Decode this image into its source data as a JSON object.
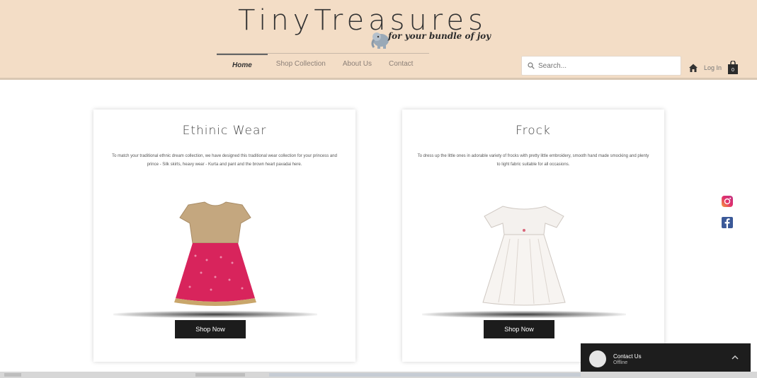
{
  "header": {
    "brand": "TinyTreasures",
    "tagline": "for your bundle of joy",
    "nav": [
      {
        "label": "Home",
        "active": true
      },
      {
        "label": "Shop Collection",
        "active": false
      },
      {
        "label": "About Us",
        "active": false
      },
      {
        "label": "Contact",
        "active": false
      }
    ],
    "search_placeholder": "Search...",
    "login_label": "Log In"
  },
  "cards": [
    {
      "title": "Ethinic Wear",
      "description": "To match your traditional ethnic dream collection, we have designed this traditional wear collection for your princess and prince - Silk skirts, heavy wear - Kurta and pant and the brown heart pavadai here.",
      "button": "Shop Now"
    },
    {
      "title": "Frock",
      "description": "To dress up the little ones in adorable variety of frocks with pretty little embroidery, smooth hand made smocking and plenty to light fabric suitable for all occasions.",
      "button": "Shop Now"
    }
  ],
  "chat": {
    "title": "Contact Us",
    "status": "Offline"
  },
  "colors": {
    "header_bg": "#f3ddc6",
    "button_bg": "#1c1c1c",
    "chat_bg": "#1d1d1d"
  },
  "icons": {
    "search": "search-icon",
    "home": "home-icon",
    "cart": "shopping-bag-icon",
    "instagram": "instagram-icon",
    "facebook": "facebook-icon",
    "chat_expand": "chevron-up-icon"
  }
}
